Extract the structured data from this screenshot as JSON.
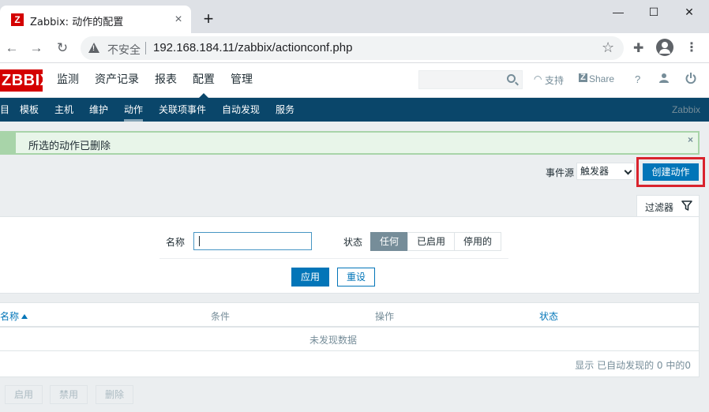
{
  "browser": {
    "tab_title": "Zabbix: 动作的配置",
    "tab_favicon": "Z",
    "tab_close": "×",
    "new_tab": "+",
    "win_min": "—",
    "win_max": "☐",
    "win_close": "✕",
    "insecure_label": "不安全",
    "url": "192.168.184.11/zabbix/actionconf.php"
  },
  "header": {
    "logo": "ZBBIX",
    "menu": [
      "监测",
      "资产记录",
      "报表",
      "配置",
      "管理"
    ],
    "active_menu": "配置",
    "support": "支持",
    "share": "Share",
    "help": "?"
  },
  "subnav": {
    "items": [
      "目",
      "模板",
      "主机",
      "维护",
      "动作",
      "关联项事件",
      "自动发现",
      "服务"
    ],
    "active": "动作",
    "brand": "Zabbix"
  },
  "message": {
    "text": "所选的动作已删除",
    "close": "×"
  },
  "toolbar": {
    "event_source_label": "事件源",
    "event_source_value": "触发器",
    "create_button": "创建动作"
  },
  "filter": {
    "tab_label": "过滤器",
    "name_label": "名称",
    "name_value": "",
    "status_label": "状态",
    "status_options": [
      "任何",
      "已启用",
      "停用的"
    ],
    "status_selected": "任何",
    "apply": "应用",
    "reset": "重设"
  },
  "table": {
    "columns": [
      "名称",
      "条件",
      "操作",
      "状态"
    ],
    "sorted_column": "名称",
    "sort_direction": "ascending",
    "empty_text": "未发现数据",
    "footer": "显示 已自动发现的 0 中的0"
  },
  "bulk_actions": [
    "启用",
    "禁用",
    "删除"
  ],
  "colors": {
    "brand_red": "#d40000",
    "nav_blue": "#0a466a",
    "primary_blue": "#0275b8",
    "success_green": "#a8d4a9",
    "highlight_red": "#d9232d"
  }
}
